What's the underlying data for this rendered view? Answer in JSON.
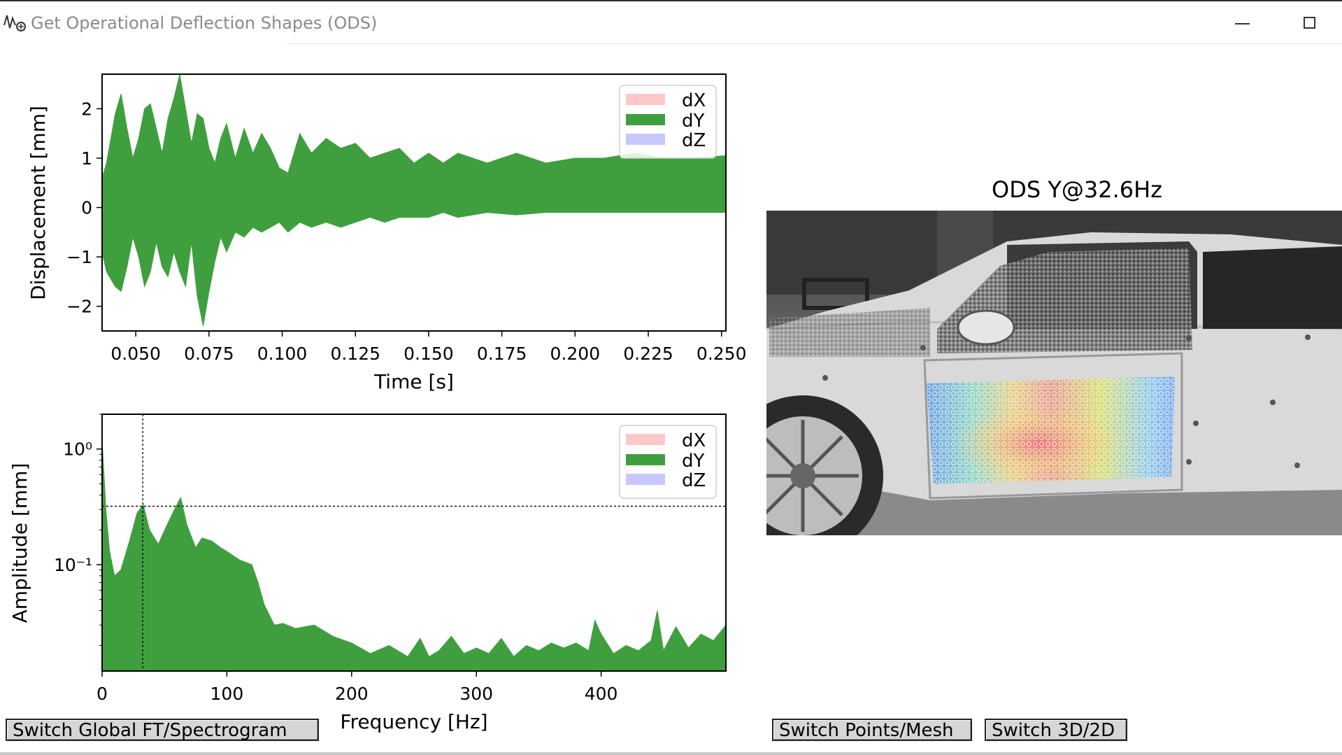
{
  "window": {
    "title": "Get Operational Deflection Shapes (ODS)",
    "minimize_icon": "minimize-icon",
    "maximize_icon": "maximize-icon",
    "app_icon": "vibration-app-icon"
  },
  "colors": {
    "dX": "#ffc8c8",
    "dY": "#3f9f3f",
    "dZ": "#c8c8ff",
    "axes": "#000000"
  },
  "time_plot": {
    "legend": [
      "dX",
      "dY",
      "dZ"
    ]
  },
  "freq_plot": {
    "legend": [
      "dX",
      "dY",
      "dZ"
    ],
    "cursor": {
      "frequency": 32.6,
      "amplitude": 0.32
    }
  },
  "ods_view": {
    "title": "ODS Y@32.6Hz",
    "image": "grayscale photo of a white car side with the front door overlaid by a color-mapped point grid (blue edges, red/yellow center)"
  },
  "buttons": {
    "switch_ft": "Switch Global FT/Spectrogram",
    "switch_points": "Switch Points/Mesh",
    "switch_3d": "Switch 3D/2D"
  },
  "chart_data": [
    {
      "type": "area",
      "title": "",
      "xlabel": "Time [s]",
      "ylabel": "Displacement [mm]",
      "xlim": [
        0.0385,
        0.2515
      ],
      "ylim": [
        -2.5,
        2.7
      ],
      "xticks": [
        "0.050",
        "0.075",
        "0.100",
        "0.125",
        "0.150",
        "0.175",
        "0.200",
        "0.225",
        "0.250"
      ],
      "xtick_values": [
        0.05,
        0.075,
        0.1,
        0.125,
        0.15,
        0.175,
        0.2,
        0.225,
        0.25
      ],
      "yticks": [
        "2",
        "1",
        "0",
        "−1",
        "−2"
      ],
      "ytick_values": [
        2,
        1,
        0,
        -1,
        -2
      ],
      "legend_position": "top-right",
      "series": [
        {
          "name": "dY",
          "x": [
            0.0385,
            0.04,
            0.043,
            0.045,
            0.047,
            0.049,
            0.051,
            0.053,
            0.055,
            0.057,
            0.059,
            0.061,
            0.063,
            0.065,
            0.067,
            0.069,
            0.071,
            0.073,
            0.075,
            0.077,
            0.079,
            0.081,
            0.084,
            0.087,
            0.09,
            0.093,
            0.096,
            0.099,
            0.102,
            0.106,
            0.11,
            0.115,
            0.12,
            0.125,
            0.13,
            0.135,
            0.14,
            0.145,
            0.15,
            0.155,
            0.16,
            0.17,
            0.18,
            0.19,
            0.2,
            0.21,
            0.22,
            0.23,
            0.24,
            0.2515
          ],
          "upper": [
            0.6,
            0.9,
            1.9,
            2.3,
            1.6,
            1.0,
            1.4,
            2.0,
            2.1,
            1.6,
            1.1,
            1.8,
            2.2,
            2.7,
            2.0,
            1.3,
            1.9,
            1.8,
            1.2,
            0.9,
            1.4,
            1.7,
            1.0,
            1.6,
            1.1,
            1.5,
            1.2,
            0.8,
            0.7,
            1.5,
            1.1,
            1.4,
            1.2,
            1.3,
            1.0,
            1.1,
            1.2,
            0.9,
            1.1,
            0.9,
            1.1,
            0.9,
            1.1,
            0.9,
            1.0,
            1.0,
            1.1,
            1.0,
            1.0,
            1.05
          ],
          "lower": [
            -0.9,
            -1.3,
            -1.6,
            -1.7,
            -1.2,
            -0.6,
            -1.0,
            -1.6,
            -1.3,
            -0.7,
            -1.2,
            -1.4,
            -0.9,
            -1.3,
            -1.6,
            -0.7,
            -1.8,
            -2.4,
            -1.7,
            -1.1,
            -0.6,
            -0.9,
            -0.5,
            -0.6,
            -0.4,
            -0.5,
            -0.4,
            -0.3,
            -0.5,
            -0.3,
            -0.4,
            -0.3,
            -0.4,
            -0.3,
            -0.2,
            -0.3,
            -0.2,
            -0.2,
            -0.2,
            -0.1,
            -0.2,
            -0.1,
            -0.15,
            -0.1,
            -0.1,
            -0.1,
            -0.1,
            -0.1,
            -0.1,
            -0.1
          ]
        }
      ]
    },
    {
      "type": "area",
      "title": "",
      "xlabel": "Frequency [Hz]",
      "ylabel": "Amplitude [mm]",
      "yscale": "log",
      "xlim": [
        0,
        500
      ],
      "ylim": [
        0.012,
        2.0
      ],
      "xticks": [
        "0",
        "100",
        "200",
        "300",
        "400"
      ],
      "xtick_values": [
        0,
        100,
        200,
        300,
        400
      ],
      "yticks": [
        "10⁰",
        "10⁻¹"
      ],
      "ytick_values": [
        1,
        0.1
      ],
      "legend_position": "top-right",
      "series": [
        {
          "name": "dY",
          "x": [
            0,
            3,
            6,
            10,
            15,
            22,
            28,
            33,
            38,
            45,
            52,
            58,
            63,
            68,
            75,
            80,
            88,
            95,
            100,
            110,
            120,
            125,
            130,
            138,
            145,
            155,
            170,
            185,
            200,
            215,
            230,
            245,
            255,
            262,
            270,
            280,
            290,
            300,
            310,
            320,
            330,
            340,
            350,
            360,
            370,
            380,
            390,
            395,
            400,
            410,
            420,
            430,
            440,
            445,
            450,
            460,
            470,
            480,
            490,
            500
          ],
          "values": [
            1.2,
            0.3,
            0.13,
            0.08,
            0.09,
            0.16,
            0.28,
            0.33,
            0.2,
            0.15,
            0.22,
            0.3,
            0.38,
            0.22,
            0.14,
            0.17,
            0.16,
            0.14,
            0.13,
            0.11,
            0.1,
            0.07,
            0.045,
            0.03,
            0.031,
            0.028,
            0.03,
            0.024,
            0.021,
            0.017,
            0.02,
            0.016,
            0.023,
            0.016,
            0.018,
            0.024,
            0.017,
            0.019,
            0.017,
            0.023,
            0.016,
            0.02,
            0.018,
            0.021,
            0.019,
            0.021,
            0.018,
            0.033,
            0.025,
            0.017,
            0.02,
            0.018,
            0.022,
            0.04,
            0.018,
            0.029,
            0.019,
            0.025,
            0.022,
            0.03
          ]
        }
      ]
    }
  ]
}
